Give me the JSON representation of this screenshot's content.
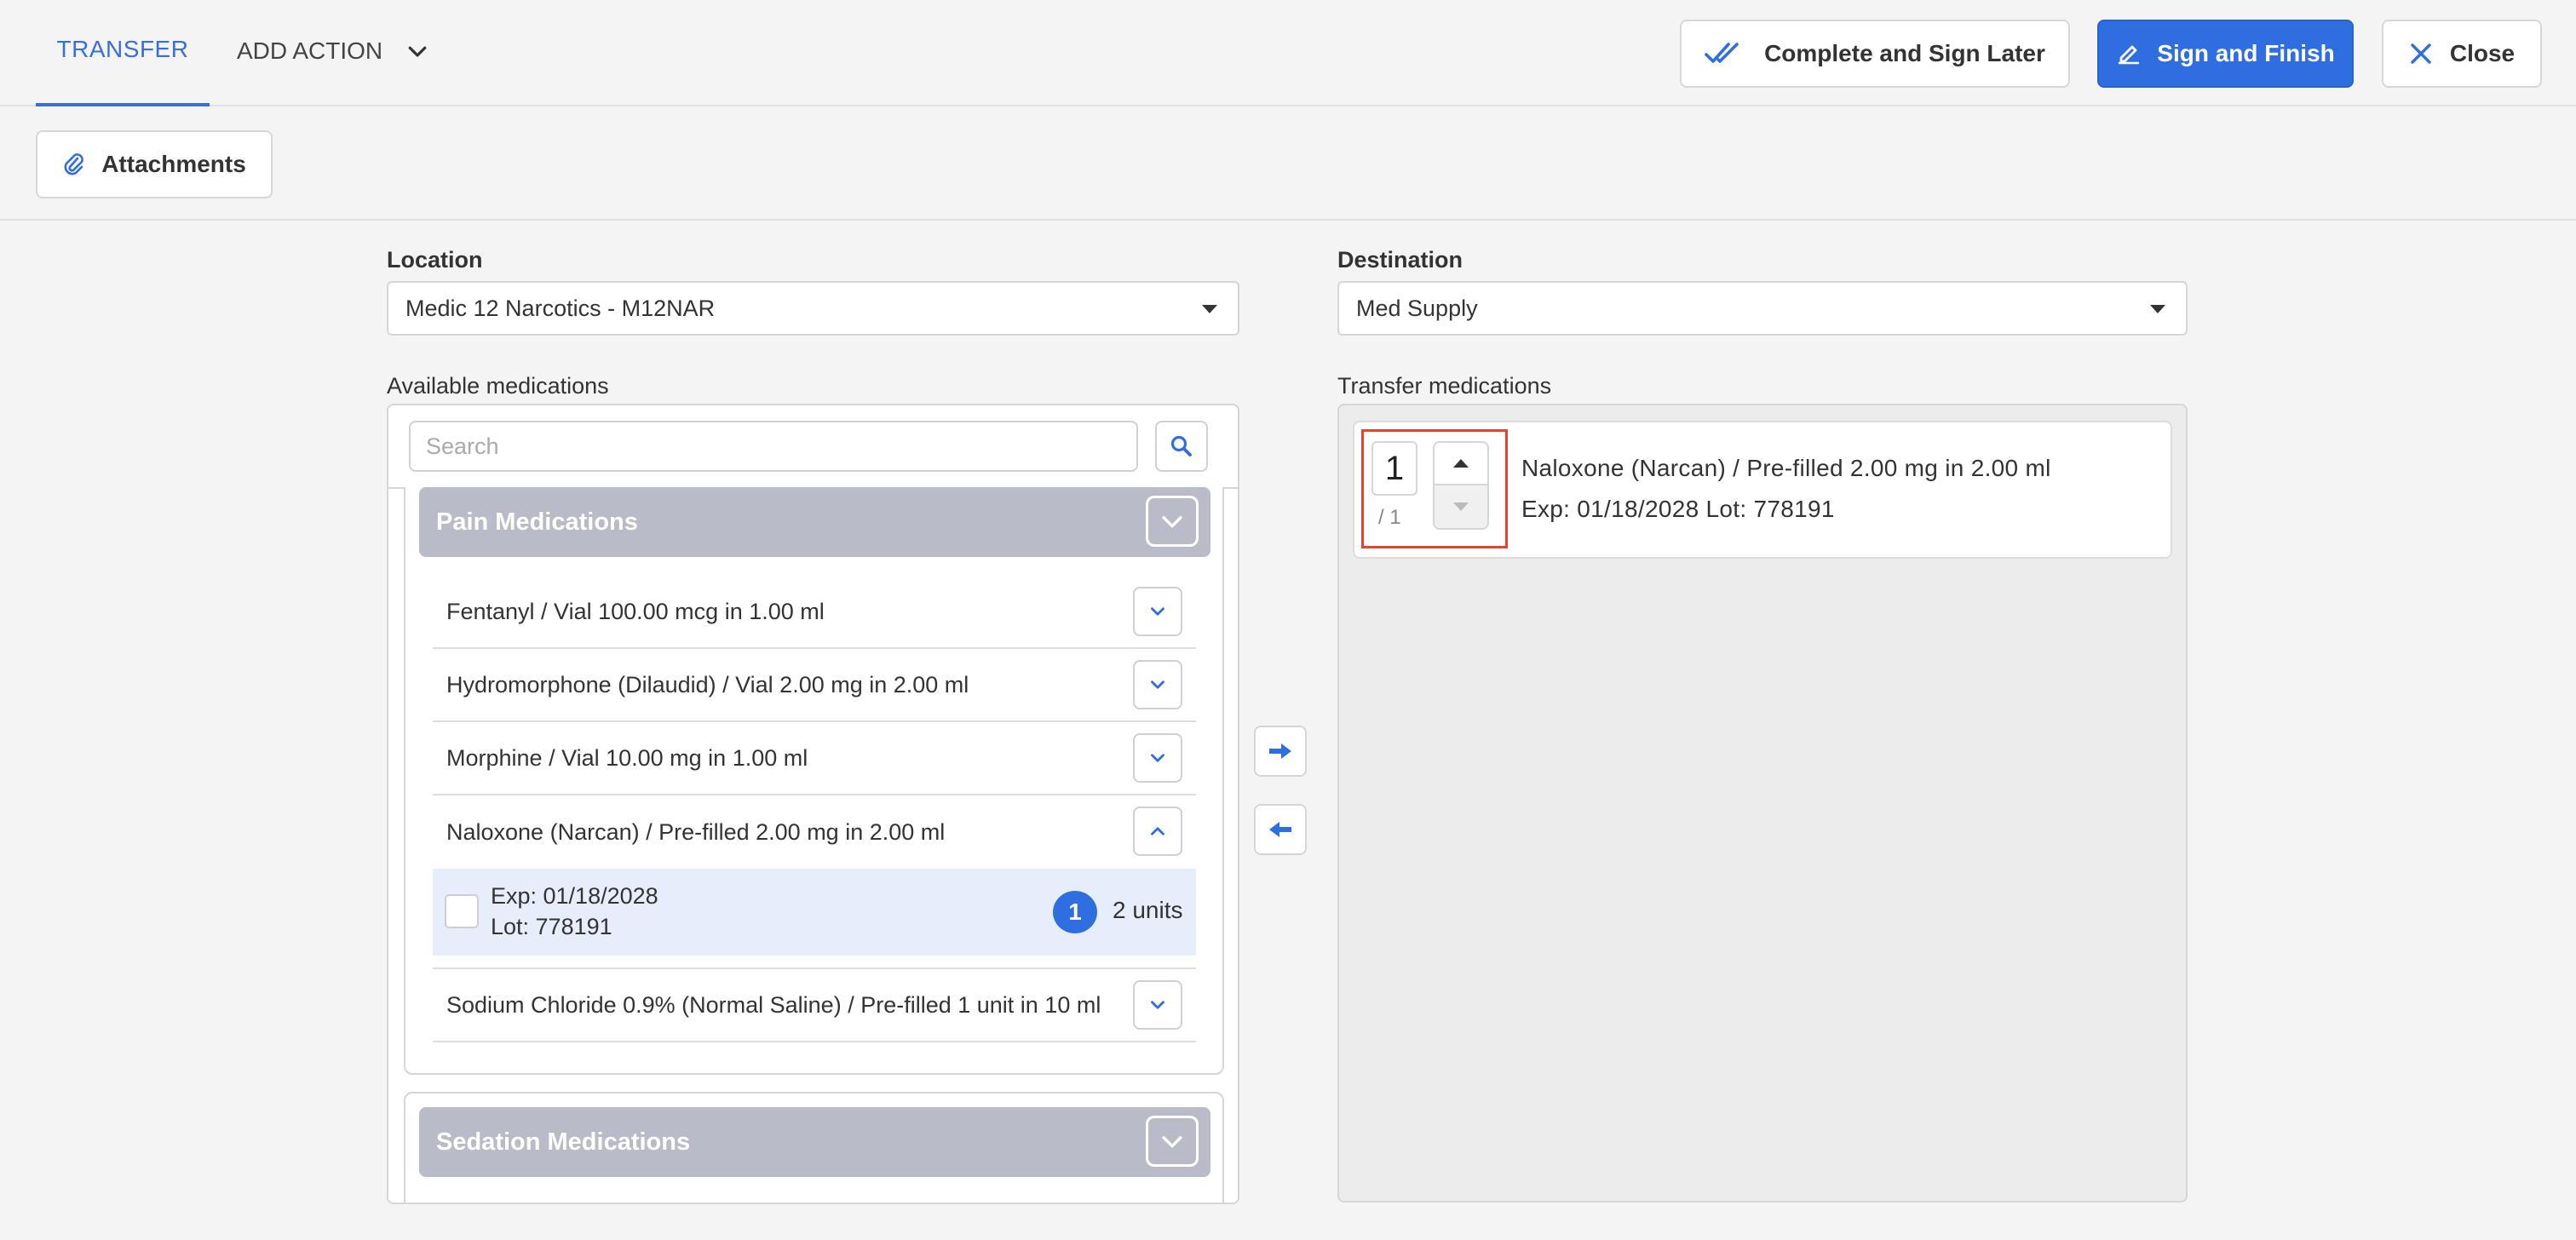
{
  "tabs": {
    "transfer_label": "TRANSFER",
    "add_action_label": "ADD ACTION"
  },
  "toolbar": {
    "complete_later_label": "Complete and Sign Later",
    "sign_finish_label": "Sign and Finish",
    "close_label": "Close",
    "attachments_label": "Attachments"
  },
  "colors": {
    "accent": "#2f6ee0",
    "group_header": "#b9bcc8",
    "selected_row": "#e6edfb",
    "highlight": "#e5432e"
  },
  "location": {
    "label": "Location",
    "value": "Medic 12 Narcotics - M12NAR"
  },
  "destination": {
    "label": "Destination",
    "value": "Med Supply"
  },
  "available": {
    "label": "Available medications",
    "search_placeholder": "Search",
    "groups": [
      {
        "name": "Pain Medications",
        "items": [
          {
            "label": "Fentanyl / Vial 100.00 mcg in 1.00 ml"
          },
          {
            "label": "Hydromorphone (Dilaudid) / Vial 2.00 mg in 2.00 ml"
          },
          {
            "label": "Morphine / Vial 10.00 mg in 1.00 ml"
          },
          {
            "label": "Naloxone (Narcan) / Pre-filled 2.00 mg in 2.00 ml",
            "lot": {
              "exp": "Exp: 01/18/2028",
              "lot": "Lot: 778191",
              "selected_count": "1",
              "units": "2 units"
            }
          },
          {
            "label": "Sodium Chloride 0.9% (Normal Saline) / Pre-filled 1 unit in 10 ml"
          }
        ]
      },
      {
        "name": "Sedation Medications"
      }
    ]
  },
  "transfer": {
    "label": "Transfer medications",
    "items": [
      {
        "qty": "1",
        "max": "/ 1",
        "name": "Naloxone (Narcan) / Pre-filled 2.00 mg in 2.00 ml",
        "details": "Exp: 01/18/2028 Lot: 778191"
      }
    ]
  }
}
